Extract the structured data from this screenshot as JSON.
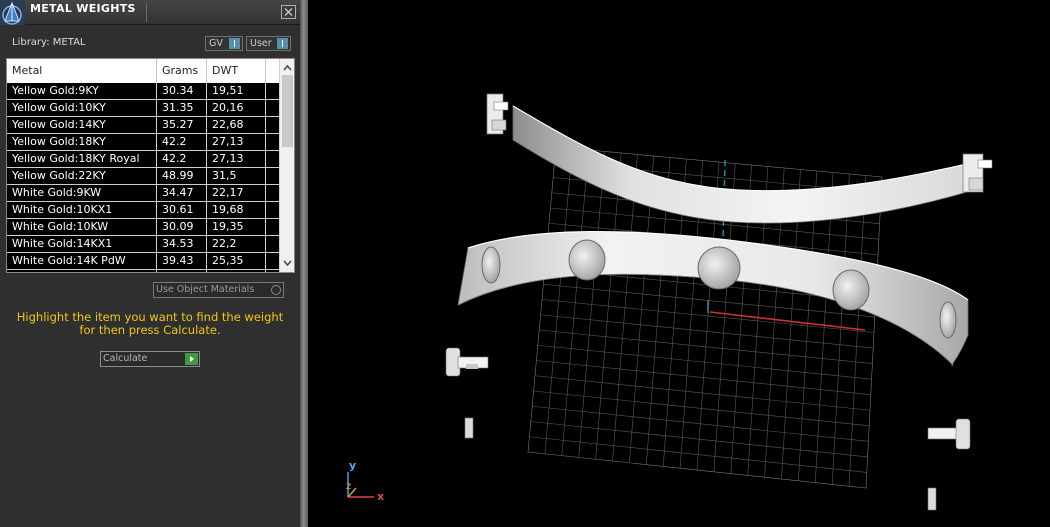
{
  "panel": {
    "title": "METAL WEIGHTS",
    "library_label": "Library: METAL",
    "toggle_gv": "GV",
    "toggle_user": "User",
    "columns": [
      "Metal",
      "Grams",
      "DWT"
    ],
    "rows": [
      {
        "metal": "Yellow Gold:9KY",
        "grams": "30.34",
        "dwt": "19,51"
      },
      {
        "metal": "Yellow Gold:10KY",
        "grams": "31.35",
        "dwt": "20,16"
      },
      {
        "metal": "Yellow Gold:14KY",
        "grams": "35.27",
        "dwt": "22,68"
      },
      {
        "metal": "Yellow Gold:18KY",
        "grams": "42.2",
        "dwt": "27,13"
      },
      {
        "metal": "Yellow Gold:18KY Royal",
        "grams": "42.2",
        "dwt": "27,13"
      },
      {
        "metal": "Yellow Gold:22KY",
        "grams": "48.99",
        "dwt": "31,5"
      },
      {
        "metal": "White Gold:9KW",
        "grams": "34.47",
        "dwt": "22,17"
      },
      {
        "metal": "White Gold:10KX1",
        "grams": "30.61",
        "dwt": "19,68"
      },
      {
        "metal": "White Gold:10KW",
        "grams": "30.09",
        "dwt": "19,35"
      },
      {
        "metal": "White Gold:14KX1",
        "grams": "34.53",
        "dwt": "22,2"
      },
      {
        "metal": "White Gold:14K PdW",
        "grams": "39.43",
        "dwt": "25,35"
      }
    ],
    "use_object_materials": "Use Object Materials",
    "instructions": "Highlight the item you want to find the weight for then press Calculate.",
    "calculate_label": "Calculate"
  },
  "viewport": {
    "axis_y": "y",
    "axis_z": "z",
    "axis_x": "x"
  },
  "colors": {
    "instruction_text": "#f0c814",
    "toggle_knob": "#5a8fa8",
    "calc_play": "#3f9a3f",
    "axis_x": "#e04848",
    "axis_y": "#4fa9ff",
    "axis_z": "#e0a030"
  }
}
